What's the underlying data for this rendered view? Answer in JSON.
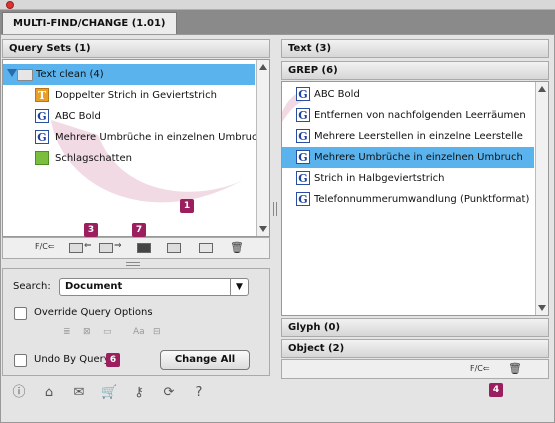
{
  "window": {
    "tab_title": "MULTI-FIND/CHANGE (1.01)"
  },
  "query_sets": {
    "header": "Query Sets (1)",
    "folder": {
      "label": "Text clean (4)"
    },
    "items": [
      {
        "label": "Doppelter Strich in Geviertstrich",
        "icon": "t-icon"
      },
      {
        "label": "ABC Bold",
        "icon": "g-icon"
      },
      {
        "label": "Mehrere Umbrüche in einzelnen Umbruch",
        "icon": "g-icon"
      },
      {
        "label": "Schlagschatten",
        "icon": "s-icon"
      }
    ],
    "toolbar": [
      "move-left-icon",
      "move-down-left-icon",
      "move-down-right-icon",
      "image-icon",
      "duplicate-icon",
      "folder-icon",
      "trash-icon"
    ],
    "toolbar_first_label": "F/C"
  },
  "options": {
    "search_label": "Search:",
    "search_value": "Document",
    "override_label": "Override Query Options",
    "undo_label": "Undo By Query",
    "change_all_label": "Change All",
    "option_icons": [
      "layers-icon",
      "lock-icon",
      "hidden-icon",
      "case-icon",
      "words-icon"
    ],
    "case_icon_text": "Aa"
  },
  "right_panel": {
    "text_header": "Text (3)",
    "grep_header": "GREP (6)",
    "grep_items": [
      {
        "label": "ABC Bold",
        "selected": false
      },
      {
        "label": "Entfernen von nachfolgenden Leerräumen",
        "selected": false
      },
      {
        "label": "Mehrere Leerstellen in einzelne Leerstelle",
        "selected": false
      },
      {
        "label": "Mehrere Umbrüche in einzelnen Umbruch",
        "selected": true
      },
      {
        "label": "Strich in Halbgeviertstrich",
        "selected": false
      },
      {
        "label": "Telefonnummerumwandlung (Punktformat)",
        "selected": false
      }
    ],
    "glyph_header": "Glyph (0)",
    "object_header": "Object (2)",
    "footer_label": "F/C"
  },
  "badges": [
    "1",
    "3",
    "7",
    "6",
    "4"
  ],
  "bottom_icons": [
    "info-icon",
    "home-icon",
    "mail-icon",
    "cart-icon",
    "key-icon",
    "refresh-icon",
    "help-icon"
  ],
  "bottom_glyphs": {
    "info": "ⓘ",
    "home": "⌂",
    "mail": "✉",
    "cart": "🛒",
    "key": "⚷",
    "refresh": "⟳",
    "help": "?"
  },
  "g_letter": "G",
  "t_letter": "T",
  "colors": {
    "selection": "#5ab3ec",
    "badge": "#9b1f5e",
    "swoosh": "#c66b95"
  }
}
